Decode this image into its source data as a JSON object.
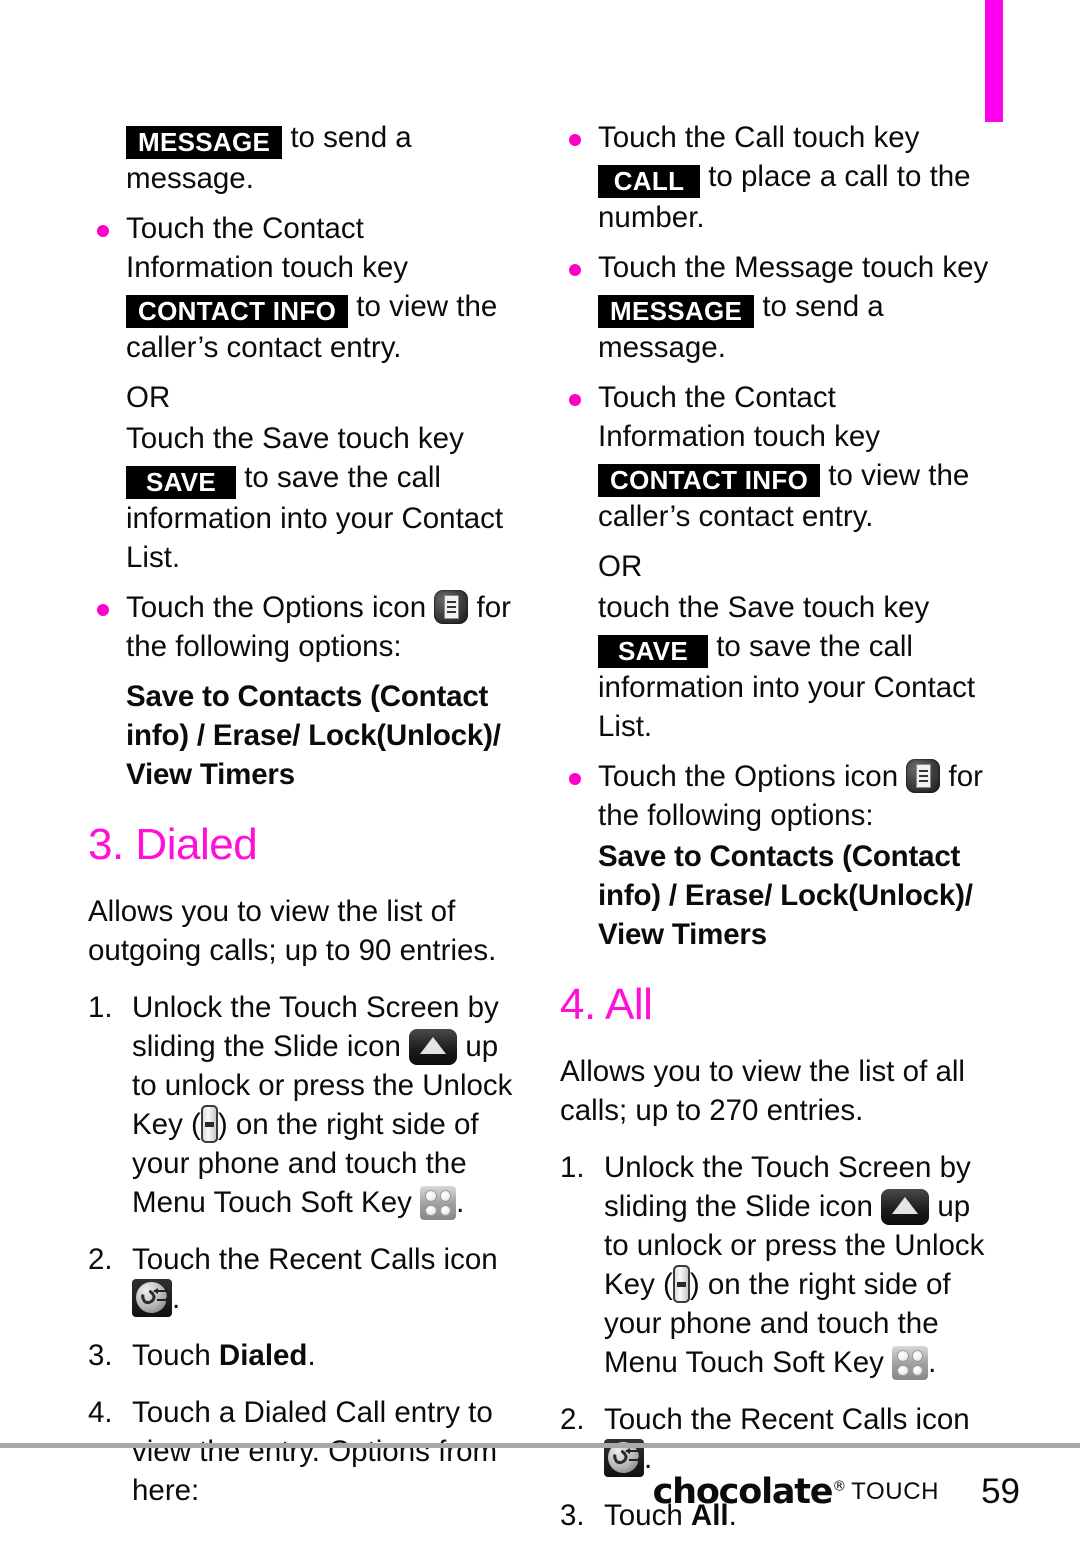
{
  "page": {
    "number": "59",
    "brand_name": "chocolate",
    "brand_reg": "®",
    "brand_sub": "TOUCH",
    "tab_color": "#ff00ee",
    "heading_color": "#ff0fd8",
    "bullet_color": "#ff00c8"
  },
  "keys": {
    "message": "MESSAGE",
    "contact_info": "CONTACT INFO",
    "save": "SAVE",
    "call": "CALL"
  },
  "icons": {
    "options": "options-icon",
    "slide": "slide-icon",
    "unlock": "unlock-key-icon",
    "menu_soft_key": "menu-soft-key-icon",
    "recent_calls": "recent-calls-icon"
  },
  "left_column": {
    "b1_tail": "to send a message.",
    "b2_pre": "Touch the Contact Information touch key",
    "b2_post": "to view the caller’s contact entry.",
    "or": "OR",
    "save_pre": "Touch the Save touch key",
    "save_post": "to save the call information into your Contact List.",
    "options_pre": "Touch the Options icon",
    "options_post": "for the following options:",
    "options_list": "Save to Contacts (Contact info) / Erase/ Lock(Unlock)/ View Timers",
    "heading": "3. Dialed",
    "intro": "Allows you to view the list of outgoing calls; up to 90 entries.",
    "step1_num": "1.",
    "step1_a": "Unlock the Touch Screen by sliding the Slide icon",
    "step1_b": "up to unlock or press the Unlock Key (",
    "step1_c": ") on the right side of your phone and touch the Menu Touch Soft Key",
    "step1_d": ".",
    "step2_num": "2.",
    "step2_a": "Touch the Recent Calls icon",
    "step2_b": ".",
    "step3_num": "3.",
    "step3_a": "Touch ",
    "step3_bold": "Dialed",
    "step3_b": ".",
    "step4_num": "4.",
    "step4_a": "Touch a Dialed Call entry to view the entry. Options from here:"
  },
  "right_column": {
    "b1_pre": "Touch the Call touch key",
    "b1_post": "to place a call to the number.",
    "b2_pre": "Touch the Message touch key",
    "b2_post": "to send a message.",
    "b3_pre": "Touch the Contact Information touch key",
    "b3_post": "to view the caller’s contact entry.",
    "or": "OR",
    "save_pre": "touch the Save touch key",
    "save_post": "to save the call information into your Contact List.",
    "options_pre": "Touch the Options icon",
    "options_post": "for the following options:",
    "options_list": "Save to Contacts (Contact info) / Erase/ Lock(Unlock)/ View Timers",
    "heading": "4. All",
    "intro": "Allows you to view the list of all calls; up to 270 entries.",
    "step1_num": "1.",
    "step1_a": "Unlock the Touch Screen by sliding the Slide icon",
    "step1_b": "up to unlock or press the Unlock Key (",
    "step1_c": ") on the right side of your phone and touch the Menu Touch Soft Key",
    "step1_d": ".",
    "step2_num": "2.",
    "step2_a": "Touch the Recent Calls icon",
    "step2_b": ".",
    "step3_num": "3.",
    "step3_a": "Touch ",
    "step3_bold": "All",
    "step3_b": "."
  }
}
